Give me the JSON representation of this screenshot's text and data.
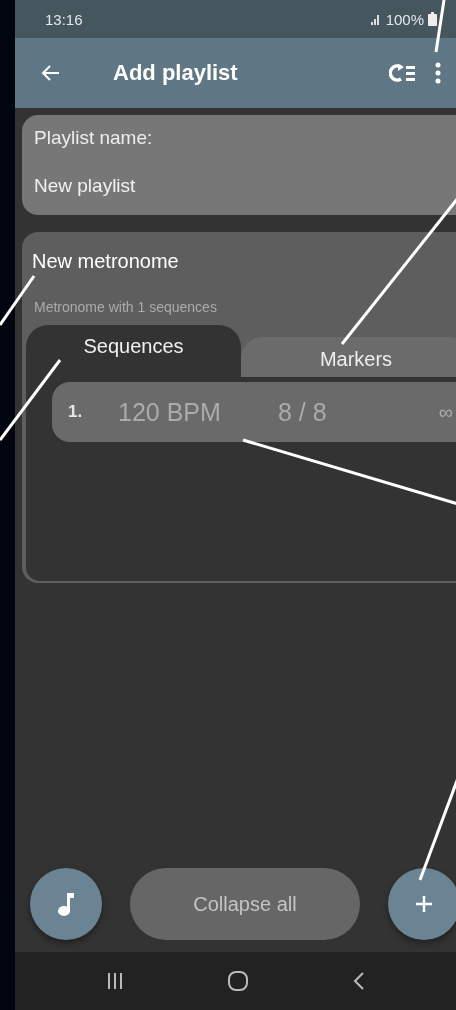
{
  "status_bar": {
    "time": "13:16",
    "battery": "100%"
  },
  "app_bar": {
    "title": "Add playlist"
  },
  "playlist_name": {
    "label": "Playlist name:",
    "value": "New playlist"
  },
  "metronome": {
    "title": "New metronome",
    "subtitle": "Metronome with 1 sequences",
    "tabs": [
      {
        "label": "Sequences",
        "selected": true
      },
      {
        "label": "Markers",
        "selected": false
      }
    ],
    "sequences": [
      {
        "number": "1.",
        "tempo": "120 BPM",
        "meter": "8 / 8",
        "repeat": "∞"
      }
    ]
  },
  "bottom_bar": {
    "collapse_button": "Collapse all"
  }
}
